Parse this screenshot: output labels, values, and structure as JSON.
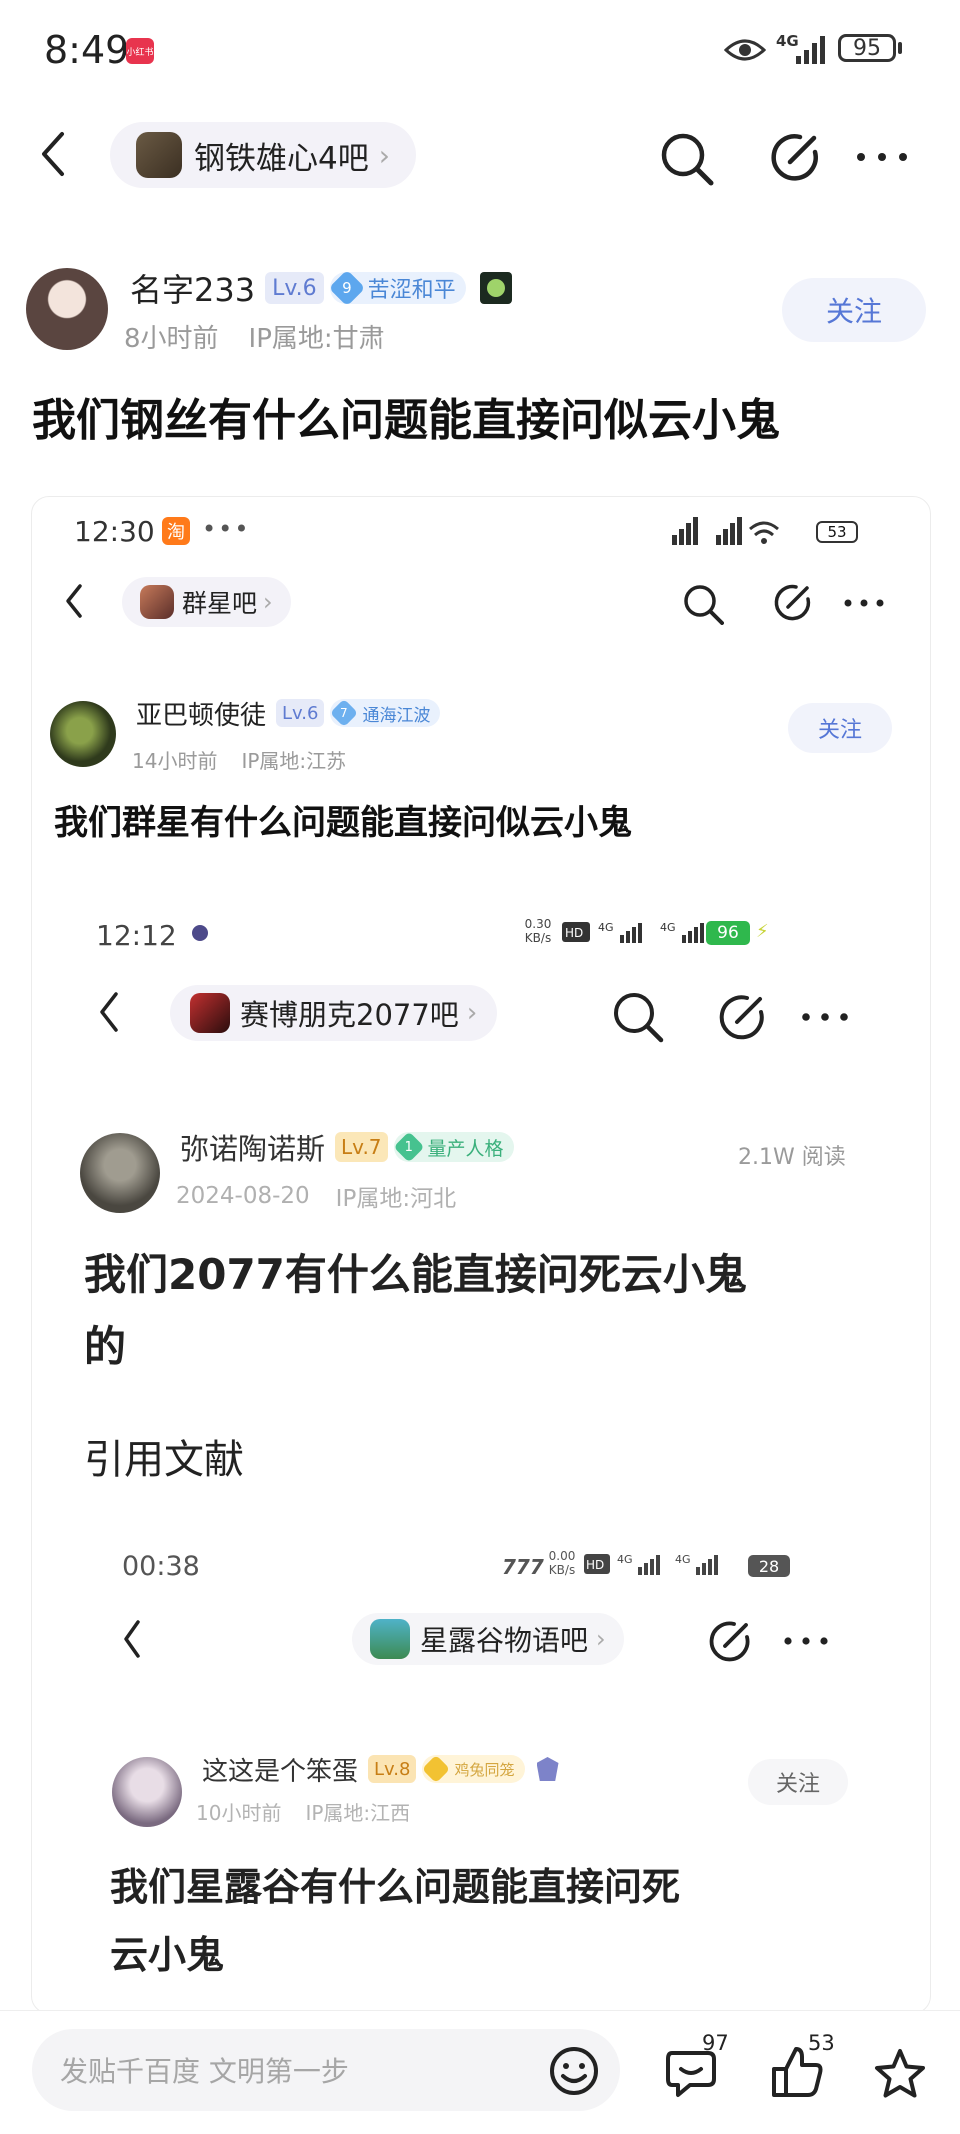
{
  "status_bar": {
    "time": "8:49",
    "app_tag": "小红书",
    "network": "4G",
    "battery": "95"
  },
  "nav": {
    "forum_name": "钢铁雄心4吧"
  },
  "post": {
    "author": "名字233",
    "level": "Lv.6",
    "badge_num": "9",
    "badge_text": "苦涩和平",
    "time": "8小时前",
    "ip": "IP属地:甘肃",
    "follow": "关注",
    "title": "我们钢丝有什么问题能直接问似云小鬼"
  },
  "shot1": {
    "time": "12:30",
    "app_tag": "淘",
    "battery": "53",
    "forum_name": "群星吧",
    "author": "亚巴顿使徒",
    "level": "Lv.6",
    "badge_num": "7",
    "badge_text": "通海江波",
    "post_time": "14小时前",
    "ip": "IP属地:江苏",
    "follow": "关注",
    "title": "我们群星有什么问题能直接问似云小鬼"
  },
  "shot2": {
    "time": "12:12",
    "speed_value": "0.30",
    "speed_unit": "KB/s",
    "battery": "96",
    "forum_name": "赛博朋克2077吧",
    "author": "弥诺陶诺斯",
    "level": "Lv.7",
    "badge_num": "1",
    "badge_text": "量产人格",
    "views": "2.1W 阅读",
    "date": "2024-08-20",
    "ip": "IP属地:河北",
    "title_line1": "我们2077有什么能直接问死云小鬼",
    "title_line2": "的",
    "body": "引用文献"
  },
  "shot3": {
    "time": "00:38",
    "speed_value": "0.00",
    "speed_unit": "KB/s",
    "battery": "28",
    "forum_name": "星露谷物语吧",
    "author": "这这是个笨蛋",
    "level": "Lv.8",
    "badge_text": "鸡兔同笼",
    "post_time": "10小时前",
    "ip": "IP属地:江西",
    "follow": "关注",
    "title_line1": "我们星露谷有什么问题能直接问死",
    "title_line2": "云小鬼"
  },
  "bottom": {
    "input_placeholder": "发贴千百度 文明第一步",
    "comment_count": "97",
    "like_count": "53"
  }
}
